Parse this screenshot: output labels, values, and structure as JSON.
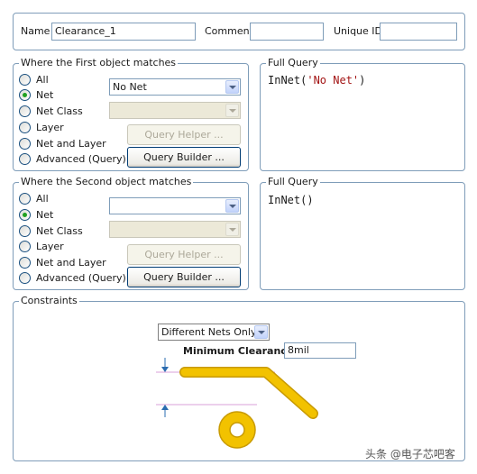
{
  "header": {
    "name_label": "Name",
    "name_value": "Clearance_1",
    "comment_label": "Comment",
    "comment_value": "",
    "unique_id_label": "Unique ID",
    "unique_id_value": ""
  },
  "first_match": {
    "title": "Where the First object matches",
    "options": [
      "All",
      "Net",
      "Net Class",
      "Layer",
      "Net and Layer",
      "Advanced (Query)"
    ],
    "selected": "Net",
    "net_value": "No Net",
    "net_class_value": "",
    "query_helper_label": "Query Helper ...",
    "query_builder_label": "Query Builder ...",
    "full_query_title": "Full Query",
    "full_query_func": "InNet(",
    "full_query_arg": "'No Net'",
    "full_query_close": ")"
  },
  "second_match": {
    "title": "Where the Second object matches",
    "options": [
      "All",
      "Net",
      "Net Class",
      "Layer",
      "Net and Layer",
      "Advanced (Query)"
    ],
    "selected": "Net",
    "net_value": "",
    "net_class_value": "",
    "query_helper_label": "Query Helper ...",
    "query_builder_label": "Query Builder ...",
    "full_query_title": "Full Query",
    "full_query_text": "InNet()"
  },
  "constraints": {
    "title": "Constraints",
    "mode_value": "Different Nets Only",
    "min_clearance_label": "Minimum Clearance",
    "min_clearance_value": "8mil"
  },
  "watermark": "头条 @电子芯吧客",
  "colors": {
    "panel_border": "#7f9db9",
    "track_fill": "#f2c200",
    "track_outline": "#c89a00",
    "dimension_arrow": "#2b6cb0",
    "query_string": "#a31515"
  }
}
